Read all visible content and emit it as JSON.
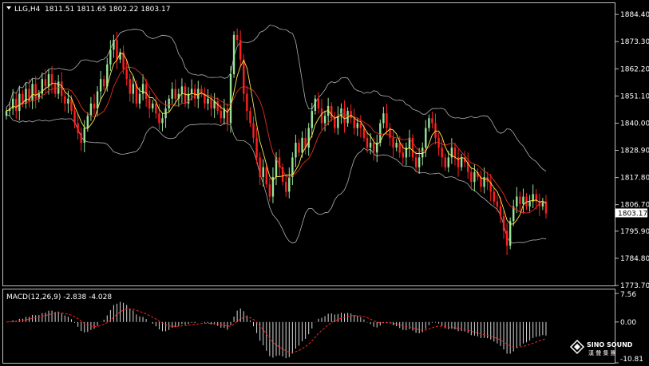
{
  "colors": {
    "background": "#000000",
    "frame": "#c0c0c0",
    "bull_candle": "#98e39a",
    "bear_candle": "#ff2020",
    "bollinger": "#b0b0b0",
    "ma_fast": "#ffe84a",
    "ma_slow": "#e03020",
    "macd_hist": "#d8d8d8",
    "macd_signal": "#ff2020",
    "price_tag_bg": "#ffffff",
    "price_tag_text": "#000000"
  },
  "header": {
    "symbol": "LLG,H4",
    "ohlc": "1811.51 1811.65 1802.22 1803.17",
    "collapse_icon": "triangle-down-icon"
  },
  "indicator_header": {
    "label": "MACD(12,26,9) -2.838 -4.028"
  },
  "price_tag": "1803.17",
  "logo": {
    "line1": "SINO SOUND",
    "line2": "漢 聲 集 團",
    "icon": "diamond-logo-icon"
  },
  "chart_data": [
    {
      "type": "candlestick",
      "timeframe": "H4",
      "y_ticks": [
        "1884.40",
        "1873.30",
        "1862.20",
        "1851.10",
        "1840.00",
        "1828.90",
        "1817.80",
        "1806.70",
        "1795.90",
        "1784.80",
        "1773.70"
      ],
      "ylim": [
        1773.7,
        1889.0
      ],
      "last_close": 1803.17,
      "indicators": [
        "Bollinger Bands",
        "Moving Average (fast)",
        "Moving Average (slow)"
      ],
      "closes": [
        1845,
        1846,
        1850,
        1845,
        1852,
        1848,
        1854,
        1849,
        1856,
        1850,
        1852,
        1858,
        1855,
        1860,
        1856,
        1852,
        1857,
        1851,
        1848,
        1850,
        1845,
        1840,
        1836,
        1832,
        1838,
        1843,
        1848,
        1846,
        1853,
        1858,
        1855,
        1864,
        1870,
        1874,
        1866,
        1869,
        1862,
        1858,
        1852,
        1856,
        1848,
        1852,
        1856,
        1850,
        1846,
        1848,
        1844,
        1840,
        1842,
        1846,
        1850,
        1854,
        1850,
        1852,
        1855,
        1848,
        1852,
        1854,
        1850,
        1854,
        1852,
        1848,
        1850,
        1846,
        1849,
        1845,
        1842,
        1846,
        1840,
        1860,
        1876,
        1874,
        1866,
        1852,
        1845,
        1840,
        1834,
        1826,
        1818,
        1822,
        1815,
        1810,
        1818,
        1826,
        1822,
        1816,
        1812,
        1818,
        1826,
        1832,
        1828,
        1834,
        1830,
        1838,
        1845,
        1850,
        1846,
        1840,
        1843,
        1847,
        1842,
        1838,
        1843,
        1846,
        1840,
        1845,
        1842,
        1838,
        1840,
        1838,
        1834,
        1830,
        1832,
        1828,
        1832,
        1840,
        1844,
        1838,
        1834,
        1830,
        1832,
        1828,
        1826,
        1830,
        1834,
        1826,
        1822,
        1826,
        1830,
        1838,
        1842,
        1840,
        1834,
        1830,
        1826,
        1822,
        1826,
        1830,
        1826,
        1822,
        1826,
        1824,
        1820,
        1816,
        1820,
        1818,
        1814,
        1818,
        1816,
        1812,
        1808,
        1806,
        1802,
        1796,
        1790,
        1800,
        1806,
        1810,
        1807,
        1810,
        1806,
        1808,
        1811,
        1808,
        1806,
        1808,
        1803.17
      ]
    },
    {
      "type": "bar",
      "name": "MACD(12,26,9)",
      "main": -2.838,
      "signal": -4.028,
      "y_ticks": [
        "7.56",
        "0.00",
        "-10.81"
      ],
      "ylim": [
        -10.81,
        7.56
      ]
    }
  ]
}
